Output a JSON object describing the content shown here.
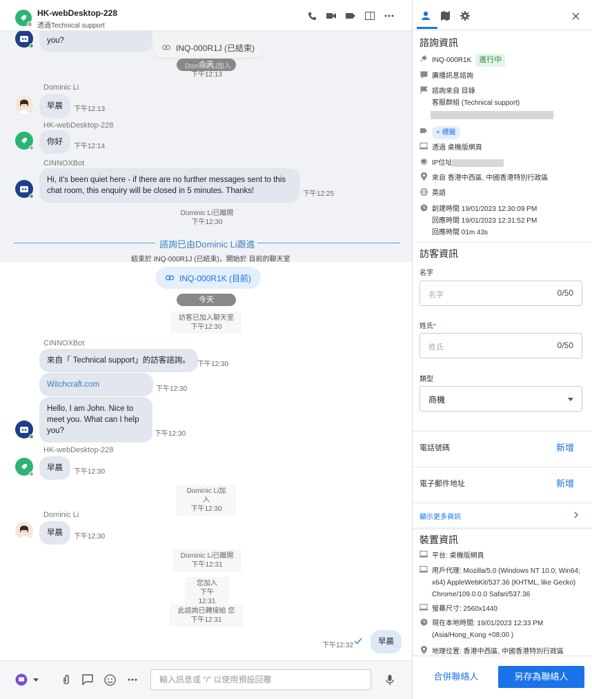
{
  "header": {
    "title": "HK-webDesktop-228",
    "subtitle": "透過Technical support"
  },
  "chat": {
    "top_partial_bubble": "you?",
    "prev_enquiry_link": "INQ-000R1J (已結束)",
    "today_label_1": "今天",
    "sys_join_partial": "Dominic Li加入",
    "sys_join_partial_time": "下午12:13",
    "msg1_sender": "Dominic Li",
    "msg1_text": "早晨",
    "msg1_time": "下午12:13",
    "msg2_sender": "HK-webDesktop-228",
    "msg2_text": "你好",
    "msg2_time": "下午12:14",
    "msg3_sender": "CINNOXBot",
    "msg3_text": "Hi, it's been quiet here - if there are no further messages sent to this chat room, this enquiry will be closed in 5  minutes. Thanks!",
    "msg3_time": "下午12:25",
    "sys_left_1": "Dominic Li已離開",
    "sys_left_1_time": "下午12:30",
    "followup_divider": "諮詢已由Dominic Li跟進",
    "followup_note": "結束於 INQ-000R1J (已結束)，開始於 目前的聊天室",
    "current_enquiry_link": "INQ-000R1K (目前)",
    "today_label_2": "今天",
    "sys_visitor_joined": "訪客已加入聊天室",
    "sys_visitor_joined_time": "下午12:30",
    "msg4_sender": "CINNOXBot",
    "msg4_text": "來自「 Technical support」的訪客諮詢。",
    "msg4_time": "下午12:30",
    "msg5_text": "Witchcraft.com",
    "msg5_time": "下午12:30",
    "msg6_text": "Hello, I am John. Nice to meet you. What can I help you?",
    "msg6_time": "下午12:30",
    "msg7_sender": "HK-webDesktop-228",
    "msg7_text": "早晨",
    "msg7_time": "下午12:30",
    "sys_join_2": "Dominic Li加入",
    "sys_join_2_time": "下午12:30",
    "msg8_sender": "Dominic Li",
    "msg8_text": "早晨",
    "msg8_time": "下午12:30",
    "sys_left_2": "Dominic Li已離開",
    "sys_left_2_time": "下午12:31",
    "sys_you_joined": "您加入",
    "sys_you_joined_time": "下午12:31",
    "sys_transferred": "此諮詢已轉接給 您",
    "sys_transferred_time": "下午12:31",
    "my_msg_text": "早晨",
    "my_msg_time": "下午12:32"
  },
  "composer": {
    "placeholder": "輸入訊息或 \"/\" 以使用預設回覆"
  },
  "panel": {
    "enquiry_section_title": "諮詢資訊",
    "enquiry_id": "INQ-000R1K",
    "enquiry_status": "進行中",
    "enquiry_type": "廣播訊息諮詢",
    "source_line": "諮詢來自 目錄",
    "source_group": "客服群組 (Technical support)",
    "add_tag": "+ 標籤",
    "via": "透過 桌機版網頁",
    "ip_label": "IP位址",
    "location": "來自 香港中西區, 中國香港特別行政區",
    "language": "英語",
    "created_time": "創建時間 19/01/2023 12:30:09 PM",
    "response_time": "回應時間 19/01/2023 12:31:52 PM",
    "response_duration": "回應時間 01m 43s",
    "visitor_section_title": "訪客資訊",
    "first_name_label": "名字",
    "first_name_placeholder": "名字",
    "first_name_count": "0/50",
    "last_name_label": "姓氏",
    "last_name_required": "*",
    "last_name_placeholder": "姓氏",
    "last_name_count": "0/50",
    "type_label": "類型",
    "type_value": "商機",
    "phone_label": "電話號碼",
    "phone_add": "新增",
    "email_label": "電子郵件地址",
    "email_add": "新增",
    "show_more": "顯示更多資訊",
    "device_section_title": "裝置資訊",
    "platform": "平台:  桌機版網頁",
    "user_agent": "用戶代理:  Mozilla/5.0 (Windows NT 10.0; Win64; x64) AppleWebKit/537.36 (KHTML, like Gecko) Chrome/109.0.0.0 Safari/537.36",
    "screen_size": "螢幕尺寸:  2560x1440",
    "local_time": "現在本地時間:  19/01/2023 12:33 PM (Asia/Hong_Kong +08:00 )",
    "geo": "地理位置:  香港中西區, 中國香港特別行政區",
    "merge_button": "合併聯絡人",
    "save_button": "另存為聯絡人"
  },
  "colors": {
    "accent": "#1a73e8",
    "green_avatar": "#2bb574",
    "bot_avatar": "#1e3f8a",
    "bubble": "#e2e6ee"
  }
}
